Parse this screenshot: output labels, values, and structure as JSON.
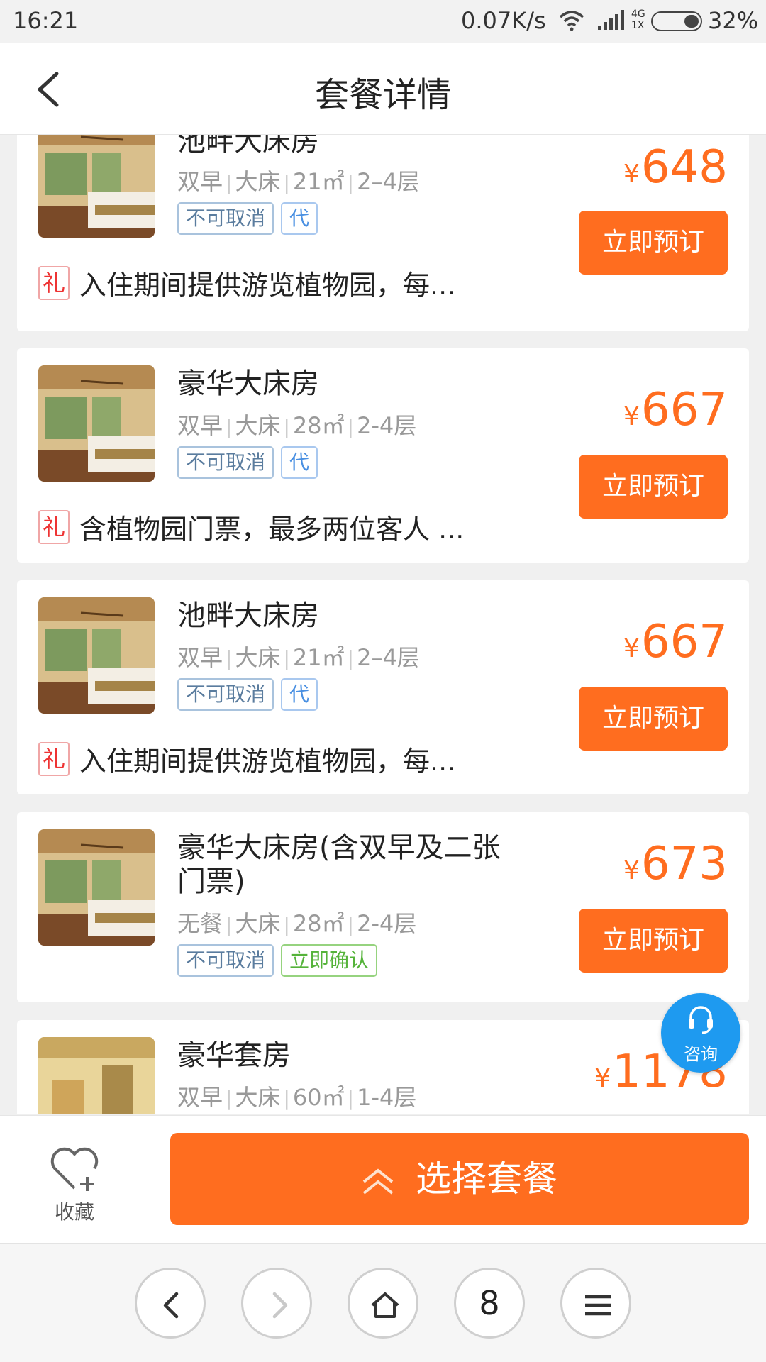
{
  "status_bar": {
    "time": "16:21",
    "speed": "0.07K/s",
    "net_top": "4G",
    "net_bottom": "1X",
    "battery": "32%"
  },
  "header": {
    "title": "套餐详情"
  },
  "rooms": [
    {
      "name": "池畔大床房",
      "specs": [
        "双早",
        "大床",
        "21㎡",
        "2–4层"
      ],
      "tags": [
        "不可取消",
        "代"
      ],
      "price": "648",
      "book": "立即预订",
      "gift_icon": "礼",
      "gift": "入住期间提供游览植物园，每..."
    },
    {
      "name": "豪华大床房",
      "specs": [
        "双早",
        "大床",
        "28㎡",
        "2-4层"
      ],
      "tags": [
        "不可取消",
        "代"
      ],
      "price": "667",
      "book": "立即预订",
      "gift_icon": "礼",
      "gift": "含植物园门票，最多两位客人 ..."
    },
    {
      "name": "池畔大床房",
      "specs": [
        "双早",
        "大床",
        "21㎡",
        "2–4层"
      ],
      "tags": [
        "不可取消",
        "代"
      ],
      "price": "667",
      "book": "立即预订",
      "gift_icon": "礼",
      "gift": "入住期间提供游览植物园，每..."
    },
    {
      "name": "豪华大床房(含双早及二张门票)",
      "specs": [
        "无餐",
        "大床",
        "28㎡",
        "2-4层"
      ],
      "tags": [
        "不可取消",
        "立即确认"
      ],
      "price": "673",
      "book": "立即预订"
    },
    {
      "name": "豪华套房",
      "specs": [
        "双早",
        "大床",
        "60㎡",
        "1-4层"
      ],
      "price": "1178"
    }
  ],
  "currency": "¥",
  "consult": {
    "label": "咨询",
    "icon": "headset-icon"
  },
  "action_bar": {
    "favorite_label": "收藏",
    "select_label": "选择套餐"
  },
  "browser_nav": {
    "tab_count": "8"
  },
  "colors": {
    "accent": "#ff6d1f",
    "consult": "#1e9af0",
    "tag_blue": "#5a7c9e",
    "tag_green": "#55b33a",
    "gift_red": "#e33333"
  }
}
